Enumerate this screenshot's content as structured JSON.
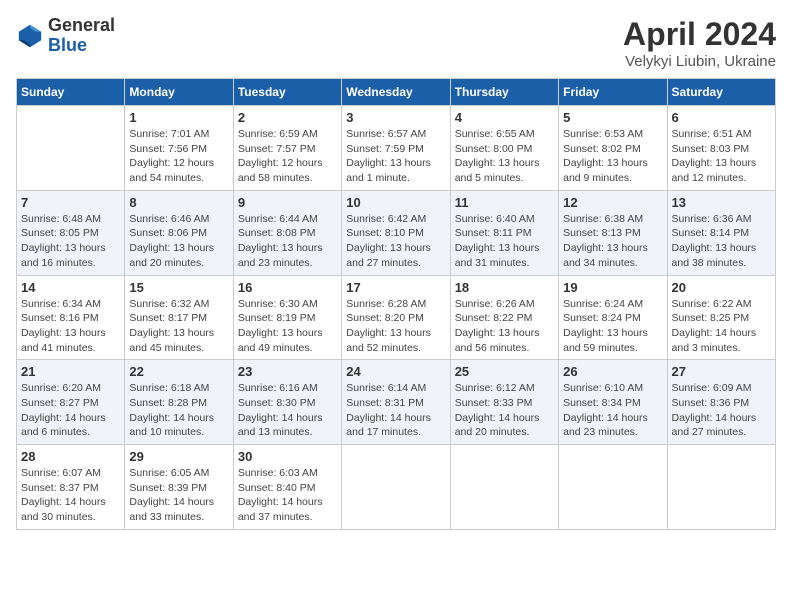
{
  "header": {
    "logo_general": "General",
    "logo_blue": "Blue",
    "month_title": "April 2024",
    "location": "Velykyi Liubin, Ukraine"
  },
  "weekdays": [
    "Sunday",
    "Monday",
    "Tuesday",
    "Wednesday",
    "Thursday",
    "Friday",
    "Saturday"
  ],
  "weeks": [
    [
      {
        "day": "",
        "sunrise": "",
        "sunset": "",
        "daylight": ""
      },
      {
        "day": "1",
        "sunrise": "Sunrise: 7:01 AM",
        "sunset": "Sunset: 7:56 PM",
        "daylight": "Daylight: 12 hours and 54 minutes."
      },
      {
        "day": "2",
        "sunrise": "Sunrise: 6:59 AM",
        "sunset": "Sunset: 7:57 PM",
        "daylight": "Daylight: 12 hours and 58 minutes."
      },
      {
        "day": "3",
        "sunrise": "Sunrise: 6:57 AM",
        "sunset": "Sunset: 7:59 PM",
        "daylight": "Daylight: 13 hours and 1 minute."
      },
      {
        "day": "4",
        "sunrise": "Sunrise: 6:55 AM",
        "sunset": "Sunset: 8:00 PM",
        "daylight": "Daylight: 13 hours and 5 minutes."
      },
      {
        "day": "5",
        "sunrise": "Sunrise: 6:53 AM",
        "sunset": "Sunset: 8:02 PM",
        "daylight": "Daylight: 13 hours and 9 minutes."
      },
      {
        "day": "6",
        "sunrise": "Sunrise: 6:51 AM",
        "sunset": "Sunset: 8:03 PM",
        "daylight": "Daylight: 13 hours and 12 minutes."
      }
    ],
    [
      {
        "day": "7",
        "sunrise": "Sunrise: 6:48 AM",
        "sunset": "Sunset: 8:05 PM",
        "daylight": "Daylight: 13 hours and 16 minutes."
      },
      {
        "day": "8",
        "sunrise": "Sunrise: 6:46 AM",
        "sunset": "Sunset: 8:06 PM",
        "daylight": "Daylight: 13 hours and 20 minutes."
      },
      {
        "day": "9",
        "sunrise": "Sunrise: 6:44 AM",
        "sunset": "Sunset: 8:08 PM",
        "daylight": "Daylight: 13 hours and 23 minutes."
      },
      {
        "day": "10",
        "sunrise": "Sunrise: 6:42 AM",
        "sunset": "Sunset: 8:10 PM",
        "daylight": "Daylight: 13 hours and 27 minutes."
      },
      {
        "day": "11",
        "sunrise": "Sunrise: 6:40 AM",
        "sunset": "Sunset: 8:11 PM",
        "daylight": "Daylight: 13 hours and 31 minutes."
      },
      {
        "day": "12",
        "sunrise": "Sunrise: 6:38 AM",
        "sunset": "Sunset: 8:13 PM",
        "daylight": "Daylight: 13 hours and 34 minutes."
      },
      {
        "day": "13",
        "sunrise": "Sunrise: 6:36 AM",
        "sunset": "Sunset: 8:14 PM",
        "daylight": "Daylight: 13 hours and 38 minutes."
      }
    ],
    [
      {
        "day": "14",
        "sunrise": "Sunrise: 6:34 AM",
        "sunset": "Sunset: 8:16 PM",
        "daylight": "Daylight: 13 hours and 41 minutes."
      },
      {
        "day": "15",
        "sunrise": "Sunrise: 6:32 AM",
        "sunset": "Sunset: 8:17 PM",
        "daylight": "Daylight: 13 hours and 45 minutes."
      },
      {
        "day": "16",
        "sunrise": "Sunrise: 6:30 AM",
        "sunset": "Sunset: 8:19 PM",
        "daylight": "Daylight: 13 hours and 49 minutes."
      },
      {
        "day": "17",
        "sunrise": "Sunrise: 6:28 AM",
        "sunset": "Sunset: 8:20 PM",
        "daylight": "Daylight: 13 hours and 52 minutes."
      },
      {
        "day": "18",
        "sunrise": "Sunrise: 6:26 AM",
        "sunset": "Sunset: 8:22 PM",
        "daylight": "Daylight: 13 hours and 56 minutes."
      },
      {
        "day": "19",
        "sunrise": "Sunrise: 6:24 AM",
        "sunset": "Sunset: 8:24 PM",
        "daylight": "Daylight: 13 hours and 59 minutes."
      },
      {
        "day": "20",
        "sunrise": "Sunrise: 6:22 AM",
        "sunset": "Sunset: 8:25 PM",
        "daylight": "Daylight: 14 hours and 3 minutes."
      }
    ],
    [
      {
        "day": "21",
        "sunrise": "Sunrise: 6:20 AM",
        "sunset": "Sunset: 8:27 PM",
        "daylight": "Daylight: 14 hours and 6 minutes."
      },
      {
        "day": "22",
        "sunrise": "Sunrise: 6:18 AM",
        "sunset": "Sunset: 8:28 PM",
        "daylight": "Daylight: 14 hours and 10 minutes."
      },
      {
        "day": "23",
        "sunrise": "Sunrise: 6:16 AM",
        "sunset": "Sunset: 8:30 PM",
        "daylight": "Daylight: 14 hours and 13 minutes."
      },
      {
        "day": "24",
        "sunrise": "Sunrise: 6:14 AM",
        "sunset": "Sunset: 8:31 PM",
        "daylight": "Daylight: 14 hours and 17 minutes."
      },
      {
        "day": "25",
        "sunrise": "Sunrise: 6:12 AM",
        "sunset": "Sunset: 8:33 PM",
        "daylight": "Daylight: 14 hours and 20 minutes."
      },
      {
        "day": "26",
        "sunrise": "Sunrise: 6:10 AM",
        "sunset": "Sunset: 8:34 PM",
        "daylight": "Daylight: 14 hours and 23 minutes."
      },
      {
        "day": "27",
        "sunrise": "Sunrise: 6:09 AM",
        "sunset": "Sunset: 8:36 PM",
        "daylight": "Daylight: 14 hours and 27 minutes."
      }
    ],
    [
      {
        "day": "28",
        "sunrise": "Sunrise: 6:07 AM",
        "sunset": "Sunset: 8:37 PM",
        "daylight": "Daylight: 14 hours and 30 minutes."
      },
      {
        "day": "29",
        "sunrise": "Sunrise: 6:05 AM",
        "sunset": "Sunset: 8:39 PM",
        "daylight": "Daylight: 14 hours and 33 minutes."
      },
      {
        "day": "30",
        "sunrise": "Sunrise: 6:03 AM",
        "sunset": "Sunset: 8:40 PM",
        "daylight": "Daylight: 14 hours and 37 minutes."
      },
      {
        "day": "",
        "sunrise": "",
        "sunset": "",
        "daylight": ""
      },
      {
        "day": "",
        "sunrise": "",
        "sunset": "",
        "daylight": ""
      },
      {
        "day": "",
        "sunrise": "",
        "sunset": "",
        "daylight": ""
      },
      {
        "day": "",
        "sunrise": "",
        "sunset": "",
        "daylight": ""
      }
    ]
  ]
}
